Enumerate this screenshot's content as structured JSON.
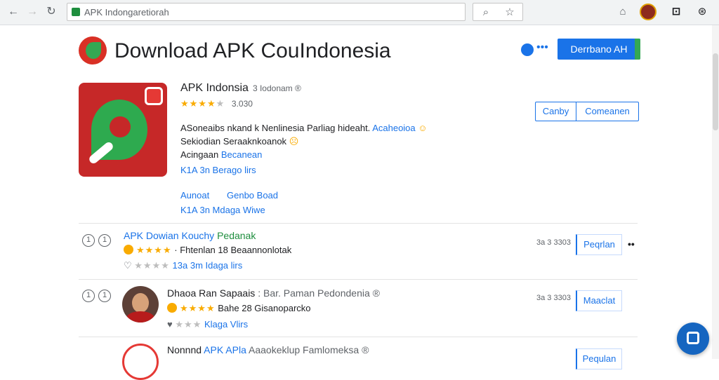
{
  "browser": {
    "url": "APK Indongaretiorah",
    "colors": {
      "secure": "#1e8e3e",
      "chrome_bg": "#f1f3f4"
    }
  },
  "header": {
    "title": "Download APK CouIndonesia",
    "download_button": "Derrbano AH"
  },
  "app": {
    "name": "APK Indonsia",
    "name_sub": "3 Iodonam ®",
    "rating_count": "3.030",
    "desc_line1": "ASoneaibs nkand k Nenlinesia Parliag hideaht.",
    "desc_line1_link": "Acaheoioa",
    "desc_line2": "Sekiodian Seraaknkoanok",
    "desc_line3_a": "Acingaan",
    "desc_line3_link": "Becanean",
    "line4": "K1A 3n  Berago lirs",
    "line5_a": "Aunoat",
    "line5_b": "Genbo Boad",
    "line6": "K1A 3n  Mdaga Wiwe",
    "btn_left": "Canby",
    "btn_right": "Comeanen",
    "colors": {
      "icon_bg": "#c62828",
      "icon_shape": "#2eaa4f"
    }
  },
  "list": [
    {
      "title": "APK Dowian Kouchy",
      "title_green": "Pedanak",
      "line1_text": "· Fhtenlan 18 Beaannonlotak",
      "line2": "13a 3m  Idaga  lirs",
      "meta": "3a 3 3303",
      "button": "Peqrlan"
    },
    {
      "title": "Dhaoa Ran Sapaais",
      "title_dim": ": Bar. Paman  Pedondenia ®",
      "line1_text": "Bahe 28 Gisanoparcko",
      "line2": "Klaga  Vlirs",
      "meta": "3a 3 3303",
      "button": "Maaclat"
    },
    {
      "title": "Nonnnd",
      "title_link": "APK APla",
      "title_dim": "Aaaokeklup Famlomeksa ®",
      "meta": "",
      "button": "Pequlan"
    }
  ],
  "icons": [
    "back-icon",
    "forward-icon",
    "reload-icon",
    "lock-icon",
    "search-icon",
    "star-icon",
    "extension-icon",
    "profile-icon",
    "menu-icon",
    "globe-icon",
    "more-icon",
    "heart-icon",
    "chat-icon"
  ]
}
